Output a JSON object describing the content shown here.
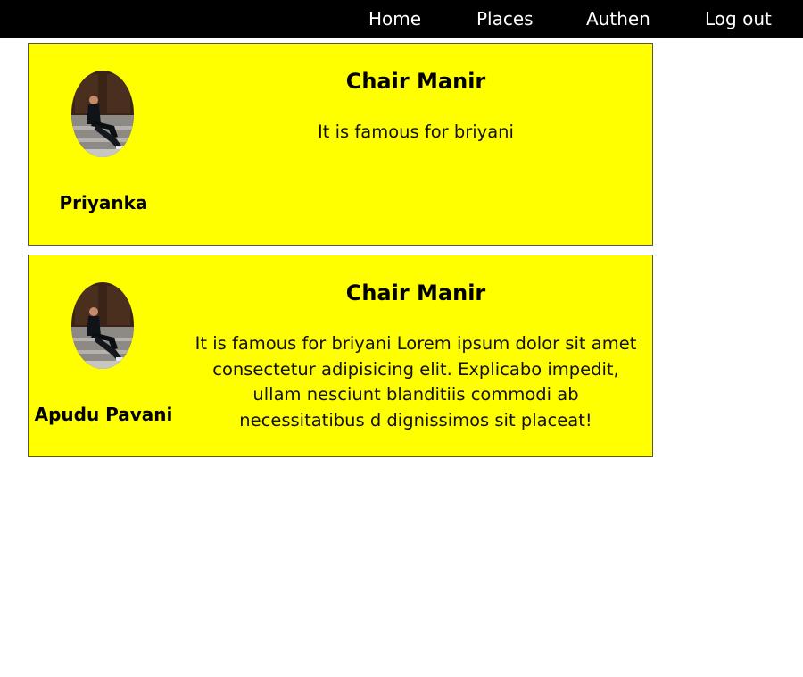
{
  "navbar": {
    "links": [
      {
        "label": "Home"
      },
      {
        "label": "Places"
      },
      {
        "label": "Authen"
      },
      {
        "label": "Log out"
      }
    ]
  },
  "posts": [
    {
      "author": "Priyanka",
      "title": "Chair Manir",
      "description": "It is famous for briyani"
    },
    {
      "author": "Apudu Pavani",
      "title": "Chair Manir",
      "description": "It is famous for briyani Lorem ipsum dolor sit amet consectetur adipisicing elit. Explicabo impedit, ullam nesciunt blanditiis commodi ab necessitatibus d dignissimos sit placeat!"
    }
  ],
  "colors": {
    "navbar_bg": "#000000",
    "card_bg": "#ffff00",
    "card_border": "#555555"
  }
}
